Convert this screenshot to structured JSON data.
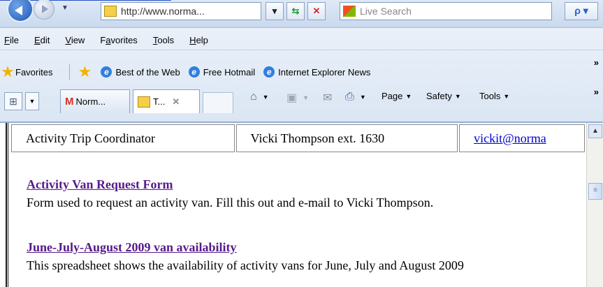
{
  "browser": {
    "address": "http://www.norma...",
    "search_placeholder": "Live Search"
  },
  "menu": [
    {
      "label": "File",
      "key": "F"
    },
    {
      "label": "Edit",
      "key": "E"
    },
    {
      "label": "View",
      "key": "V"
    },
    {
      "label": "Favorites",
      "key": "a"
    },
    {
      "label": "Tools",
      "key": "T"
    },
    {
      "label": "Help",
      "key": "H"
    }
  ],
  "favorites_bar": {
    "favorites_label": "Favorites",
    "links": [
      "Best of the Web",
      "Free Hotmail",
      "Internet Explorer News"
    ]
  },
  "tabs": [
    {
      "label": "Norm..."
    },
    {
      "label": "T..."
    }
  ],
  "commands": {
    "page": "Page",
    "safety": "Safety",
    "tools": "Tools"
  },
  "contact_row": {
    "role": "Activity Trip Coordinator",
    "name": "Vicki Thompson ext. 1630",
    "email": "vickit@norma"
  },
  "sections": [
    {
      "title": "Activity Van Request Form",
      "description": "Form used to request an activity van. Fill this out and e-mail to Vicki Thompson."
    },
    {
      "title": "June-July-August 2009 van availability",
      "description": "This spreadsheet shows the availability of activity vans for June, July and August 2009"
    }
  ]
}
